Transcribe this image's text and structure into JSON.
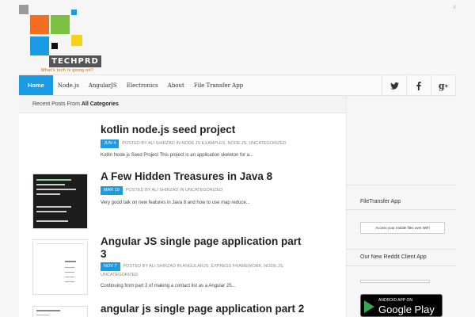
{
  "brand": {
    "logo_text": "TECHPRD",
    "tagline": "What's tech is going on?",
    "colors": [
      "#f26f21",
      "#7cc242",
      "#1a9be3",
      "#f9d11d",
      "#9a9a9a"
    ]
  },
  "close_label": "x",
  "nav": {
    "items": [
      "Home",
      "Node.js",
      "AngularJS",
      "Electronics",
      "About",
      "File Transfer App"
    ],
    "active_index": 0,
    "social": [
      {
        "icon": "twitter-icon"
      },
      {
        "icon": "facebook-icon"
      },
      {
        "icon": "google-plus-icon"
      }
    ]
  },
  "recent": {
    "prefix": "Recent Posts From ",
    "category": "All Categories"
  },
  "posts": [
    {
      "title": "kotlin node.js seed project",
      "date": "JUN 4",
      "meta": "POSTED BY ALI SHIRZAD IN NODE JS EXAMPLES, NODE.JS, UNCATEGORIZED",
      "excerpt": "Kotlin Node.js Seed Project This project is an application skeleton for a..."
    },
    {
      "title": "A Few Hidden Treasures in Java 8",
      "date": "MAR 19",
      "meta": "POSTED BY ALI SHIRZAD IN UNCATEGORIZED",
      "excerpt": "Very good talk on new features in Java 8 and how to use map reduce..."
    },
    {
      "title_line1": "Angular JS single page application part",
      "title_line2": "3",
      "date": "NOV 7",
      "meta": "POSTED BY ALI SHIRZAD IN ANGULARJS, EXPRESS FRAMEWORK, NODE.JS,",
      "meta2": "UNCATEGORIZED",
      "excerpt": "Continuing from part 2 of making a contact list as a Angular JS..."
    },
    {
      "title": "angular js single page application part 2"
    }
  ],
  "sidebar": {
    "file_transfer": {
      "title": "FileTransfer App",
      "bar_text": "Access your mobile files over WiFi"
    },
    "reddit": {
      "title": "Our New Reddit Client App"
    },
    "google_play": {
      "small": "ANDROID APP ON",
      "big": "Google Play"
    }
  }
}
